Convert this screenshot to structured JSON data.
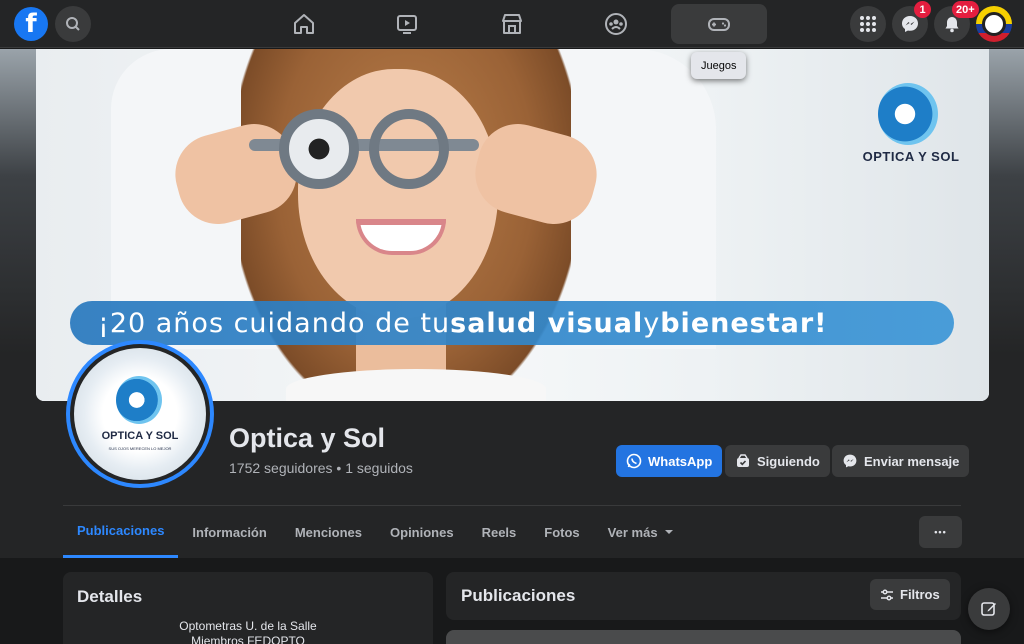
{
  "topbar": {
    "logo": "f",
    "tooltip": "Juegos",
    "messenger_badge": "1",
    "notifications_badge": "20+"
  },
  "cover": {
    "banner_prefix": "¡20 años cuidando de tu ",
    "banner_bold_1": "salud visual",
    "banner_mid": " y ",
    "banner_bold_2": "bienestar!",
    "logo_text": "OPTICA Y SOL"
  },
  "avatar": {
    "name": "OPTICA Y SOL",
    "slogan": "SUS OJOS MERECEN LO MEJOR"
  },
  "profile": {
    "name": "Optica y Sol",
    "followers": "1752 seguidores • 1 seguidos"
  },
  "actions": {
    "whatsapp": "WhatsApp",
    "following": "Siguiendo",
    "message": "Enviar mensaje"
  },
  "tabs": [
    {
      "label": "Publicaciones"
    },
    {
      "label": "Información"
    },
    {
      "label": "Menciones"
    },
    {
      "label": "Opiniones"
    },
    {
      "label": "Reels"
    },
    {
      "label": "Fotos"
    },
    {
      "label": "Ver más"
    }
  ],
  "more_dots": "•••",
  "details": {
    "title": "Detalles",
    "line1": "Optometras U. de la Salle",
    "line2": "Miembros FEDOPTO"
  },
  "posts": {
    "title": "Publicaciones",
    "filter": "Filtros"
  },
  "colors": {
    "accent": "#2d88ff",
    "primary_button": "#2374e1",
    "badge": "#e41e3f"
  }
}
